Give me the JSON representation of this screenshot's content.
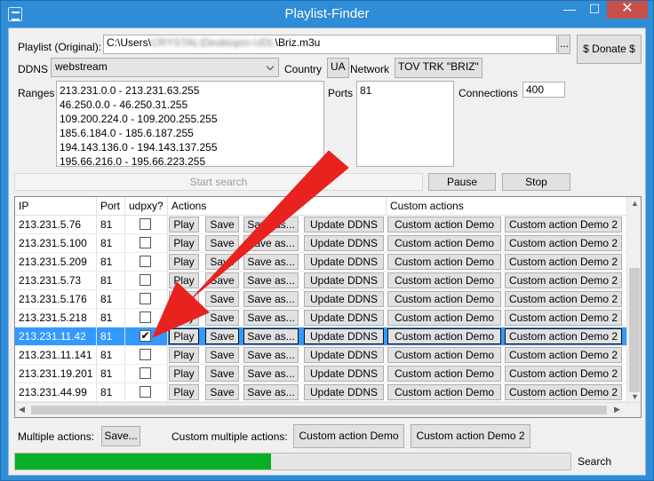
{
  "window": {
    "title": "Playlist-Finder",
    "min": "—",
    "max": "☐",
    "close": "✕"
  },
  "playlist": {
    "label": "Playlist (Original):",
    "path_prefix": "C:\\Users\\",
    "path_blurred": "CRYSTAL\\Desktop\\n-UDL",
    "path_suffix": "\\Briz.m3u",
    "browse_label": "...",
    "donate_label": "$ Donate $"
  },
  "ddns": {
    "label": "DDNS",
    "value": "webstream"
  },
  "country": {
    "label": "Country",
    "value": "UA"
  },
  "network": {
    "label": "Network",
    "value": "TOV TRK \"BRIZ\""
  },
  "ranges": {
    "label": "Ranges",
    "items": [
      "213.231.0.0 - 213.231.63.255",
      "46.250.0.0 - 46.250.31.255",
      "109.200.224.0 - 109.200.255.255",
      "185.6.184.0 - 185.6.187.255",
      "194.143.136.0 - 194.143.137.255",
      "195.66.216.0 - 195.66.223.255"
    ]
  },
  "ports": {
    "label": "Ports",
    "items": [
      "81"
    ]
  },
  "connections": {
    "label": "Connections",
    "value": "400"
  },
  "search": {
    "start_label": "Start search",
    "pause_label": "Pause",
    "stop_label": "Stop"
  },
  "grid": {
    "headers": {
      "ip": "IP",
      "port": "Port",
      "udpxy": "udpxy?",
      "actions": "Actions",
      "custom": "Custom actions"
    },
    "row_buttons": {
      "play": "Play",
      "save": "Save",
      "save_as": "Save as...",
      "update_ddns": "Update DDNS",
      "custom1": "Custom action Demo",
      "custom2": "Custom action Demo 2"
    },
    "rows": [
      {
        "ip": "213.231.5.76",
        "port": "81",
        "udpxy": false,
        "selected": false
      },
      {
        "ip": "213.231.5.100",
        "port": "81",
        "udpxy": false,
        "selected": false
      },
      {
        "ip": "213.231.5.209",
        "port": "81",
        "udpxy": false,
        "selected": false
      },
      {
        "ip": "213.231.5.73",
        "port": "81",
        "udpxy": false,
        "selected": false
      },
      {
        "ip": "213.231.5.176",
        "port": "81",
        "udpxy": false,
        "selected": false
      },
      {
        "ip": "213.231.5.218",
        "port": "81",
        "udpxy": false,
        "selected": false
      },
      {
        "ip": "213.231.11.42",
        "port": "81",
        "udpxy": true,
        "selected": true
      },
      {
        "ip": "213.231.11.141",
        "port": "81",
        "udpxy": false,
        "selected": false
      },
      {
        "ip": "213.231.19.201",
        "port": "81",
        "udpxy": false,
        "selected": false
      },
      {
        "ip": "213.231.44.99",
        "port": "81",
        "udpxy": false,
        "selected": false
      }
    ]
  },
  "bottom": {
    "multiple_label": "Multiple actions:",
    "multiple_save": "Save...",
    "custom_multiple_label": "Custom multiple actions:",
    "custom_multiple_1": "Custom action Demo",
    "custom_multiple_2": "Custom action Demo 2"
  },
  "status": {
    "progress": 0.46,
    "progress_color": "#06B025",
    "label": "Search"
  },
  "colors": {
    "titlebar": "#2F8CD6",
    "selection": "#3399FF",
    "arrow": "#E8221F",
    "close_button": "#C7504B"
  }
}
